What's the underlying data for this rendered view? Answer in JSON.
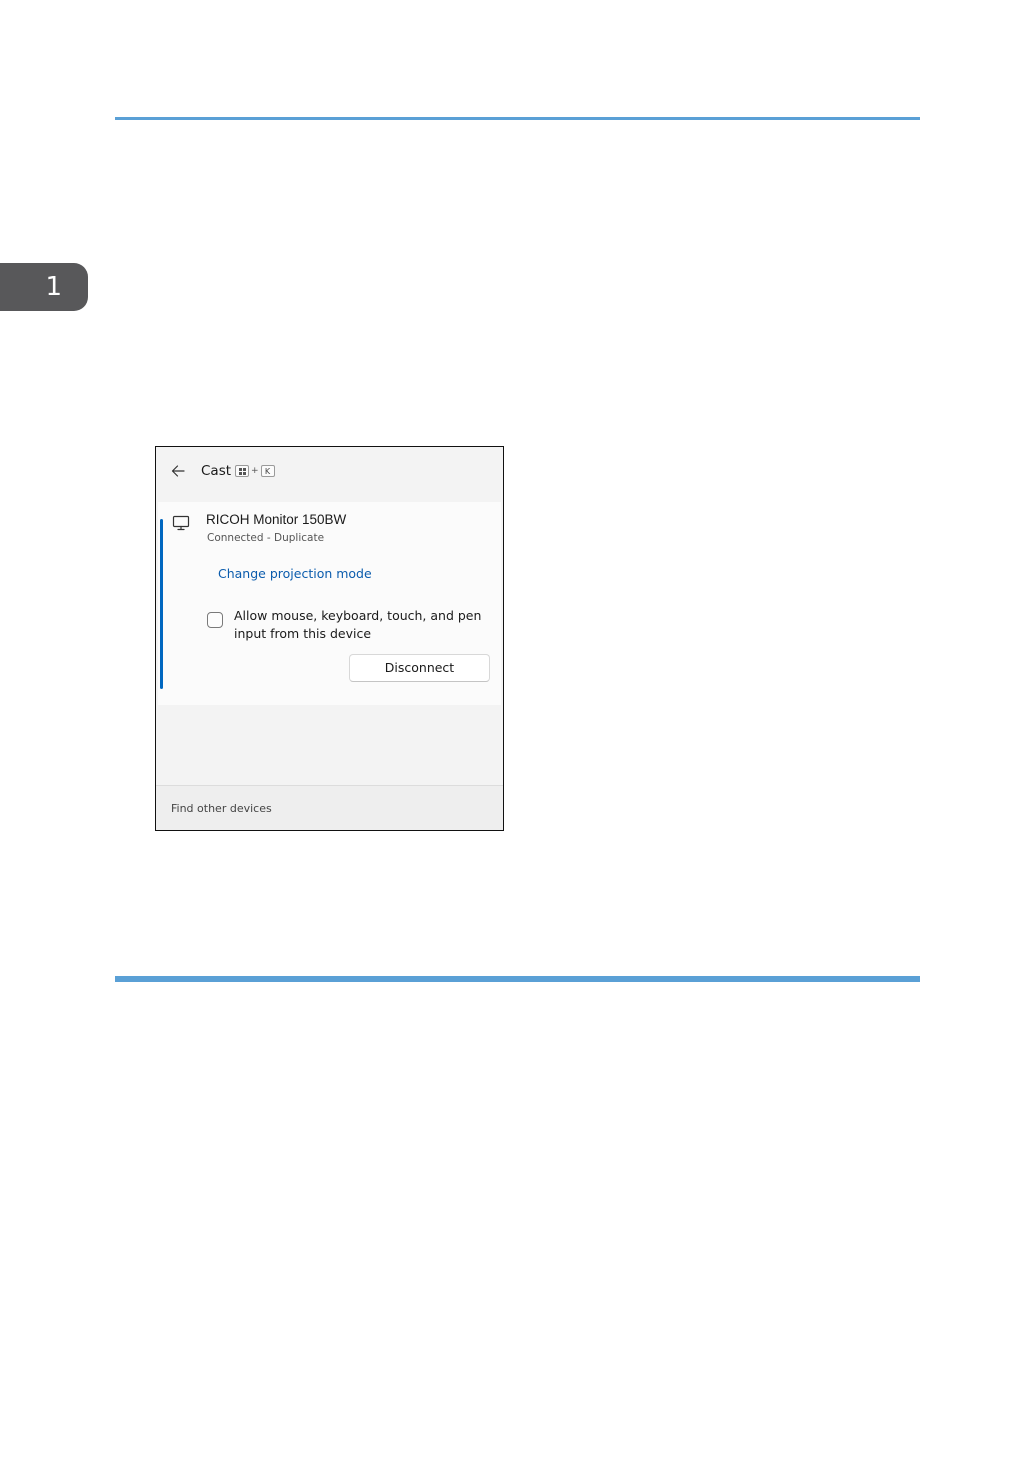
{
  "chapter": {
    "number": "1"
  },
  "cast_panel": {
    "title": "Cast",
    "shortcut": {
      "separator": "+",
      "key": "K"
    },
    "device": {
      "name": "RICOH Monitor 150BW",
      "status": "Connected - Duplicate"
    },
    "projection_link": "Change projection mode",
    "input_checkbox": {
      "label": "Allow mouse, keyboard, touch, and pen input from this device",
      "checked": false
    },
    "disconnect_label": "Disconnect",
    "find_other_devices": "Find other devices"
  },
  "colors": {
    "accent_rule": "#5aa0d6",
    "link": "#0b5cad",
    "selection_bar": "#0067c0",
    "chapter_tab": "#58585a"
  },
  "icons": {
    "back": "arrow-left-icon",
    "windows_key": "windows-logo-icon",
    "monitor": "monitor-icon"
  }
}
